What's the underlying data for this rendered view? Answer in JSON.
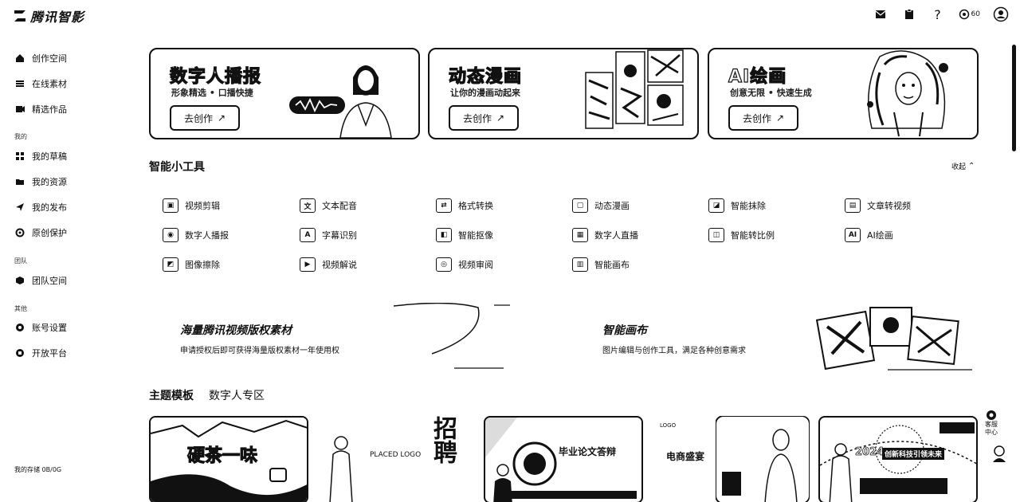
{
  "app": {
    "name": "腾讯智影"
  },
  "topbar": {
    "points": "60"
  },
  "sidebar": {
    "main": [
      {
        "label": "创作空间",
        "icon": "home-icon"
      },
      {
        "label": "在线素材",
        "icon": "layers-icon"
      },
      {
        "label": "精选作品",
        "icon": "play-icon"
      }
    ],
    "group_mine": "我的",
    "mine": [
      {
        "label": "我的草稿",
        "icon": "grid-icon"
      },
      {
        "label": "我的资源",
        "icon": "folder-icon"
      },
      {
        "label": "我的发布",
        "icon": "send-icon"
      },
      {
        "label": "原创保护",
        "icon": "shield-icon"
      }
    ],
    "group_team": "团队",
    "team": [
      {
        "label": "团队空间",
        "icon": "cube-icon"
      }
    ],
    "group_other": "其他",
    "other": [
      {
        "label": "账号设置",
        "icon": "gear-icon"
      },
      {
        "label": "开放平台",
        "icon": "plug-icon"
      }
    ],
    "storage_label": "我的存储",
    "storage_value": "0B/0G"
  },
  "banners": [
    {
      "title": "数字人播报",
      "subtitle": "形象精选 • 口播快捷",
      "button": "去创作"
    },
    {
      "title": "动态漫画",
      "subtitle": "让你的漫画动起来",
      "button": "去创作"
    },
    {
      "title": "AI绘画",
      "subtitle": "创意无限 • 快速生成",
      "button": "去创作"
    }
  ],
  "tools_section": {
    "title": "智能小工具",
    "collapse": "收起"
  },
  "tools": [
    {
      "label": "视频剪辑",
      "icon": "video-edit-icon"
    },
    {
      "label": "文本配音",
      "icon": "text-voice-icon"
    },
    {
      "label": "格式转换",
      "icon": "format-convert-icon"
    },
    {
      "label": "动态漫画",
      "icon": "comic-icon"
    },
    {
      "label": "智能抹除",
      "icon": "erase-icon"
    },
    {
      "label": "文章转视频",
      "icon": "article-video-icon"
    },
    {
      "label": "数字人播报",
      "icon": "avatar-broadcast-icon"
    },
    {
      "label": "字幕识别",
      "icon": "subtitle-icon"
    },
    {
      "label": "智能抠像",
      "icon": "matting-icon"
    },
    {
      "label": "数字人直播",
      "icon": "live-icon"
    },
    {
      "label": "智能转比例",
      "icon": "ratio-icon"
    },
    {
      "label": "AI绘画",
      "icon": "ai-paint-icon"
    },
    {
      "label": "图像擦除",
      "icon": "image-erase-icon"
    },
    {
      "label": "视频解说",
      "icon": "video-narration-icon"
    },
    {
      "label": "视频审阅",
      "icon": "review-icon"
    },
    {
      "label": "智能画布",
      "icon": "canvas-icon"
    }
  ],
  "promos": [
    {
      "title": "海量腾讯视频版权素材",
      "subtitle": "申请授权后即可获得海量版权素材一年使用权"
    },
    {
      "title": "智能画布",
      "subtitle": "图片编辑与创作工具，满足各种创意需求"
    }
  ],
  "themes": {
    "tabs": [
      "主题模板",
      "数字人专区"
    ]
  },
  "templates": [
    {
      "text": "硬茶一味"
    },
    {
      "text": "PLACED LOGO",
      "text2": "招聘"
    },
    {
      "text": "毕业论文答辩"
    },
    {
      "text": "LOGO",
      "text2": "电商盛宴"
    },
    {
      "text": "2024",
      "text2": "创新科技引领未来"
    }
  ],
  "float": {
    "service": "客服中心"
  }
}
